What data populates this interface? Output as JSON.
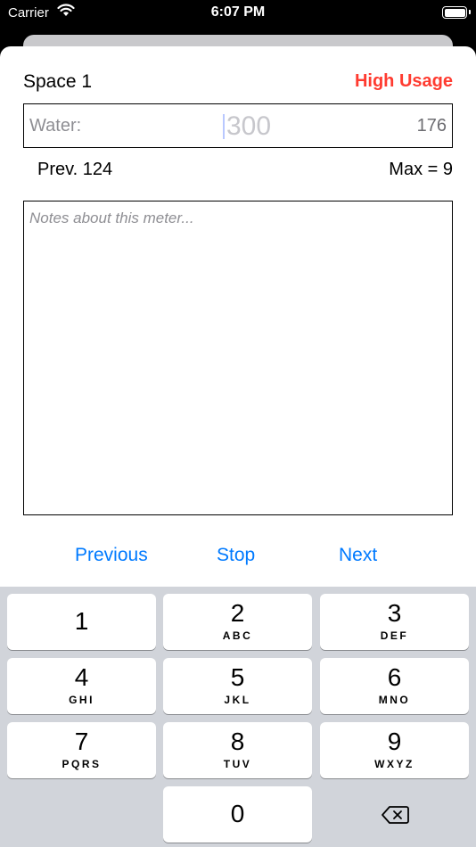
{
  "status_bar": {
    "carrier": "Carrier",
    "time": "6:07 PM",
    "wifi_icon": "wifi-icon",
    "battery_icon": "battery-icon"
  },
  "meter": {
    "space_title": "Space 1",
    "usage_alert": "High Usage",
    "usage_alert_color": "#ff3b30",
    "reading_label": "Water:",
    "reading_placeholder": "300",
    "usage_value": "176",
    "previous": "Prev. 124",
    "max": "Max = 9",
    "notes_placeholder": "Notes about this meter..."
  },
  "navigation": {
    "previous_label": "Previous",
    "stop_label": "Stop",
    "next_label": "Next",
    "accent_color": "#007aff"
  },
  "keypad": {
    "keys": [
      {
        "digit": "1",
        "letters": ""
      },
      {
        "digit": "2",
        "letters": "ABC"
      },
      {
        "digit": "3",
        "letters": "DEF"
      },
      {
        "digit": "4",
        "letters": "GHI"
      },
      {
        "digit": "5",
        "letters": "JKL"
      },
      {
        "digit": "6",
        "letters": "MNO"
      },
      {
        "digit": "7",
        "letters": "PQRS"
      },
      {
        "digit": "8",
        "letters": "TUV"
      },
      {
        "digit": "9",
        "letters": "WXYZ"
      },
      {
        "digit": "0",
        "letters": ""
      }
    ],
    "delete_icon": "backspace-icon"
  }
}
